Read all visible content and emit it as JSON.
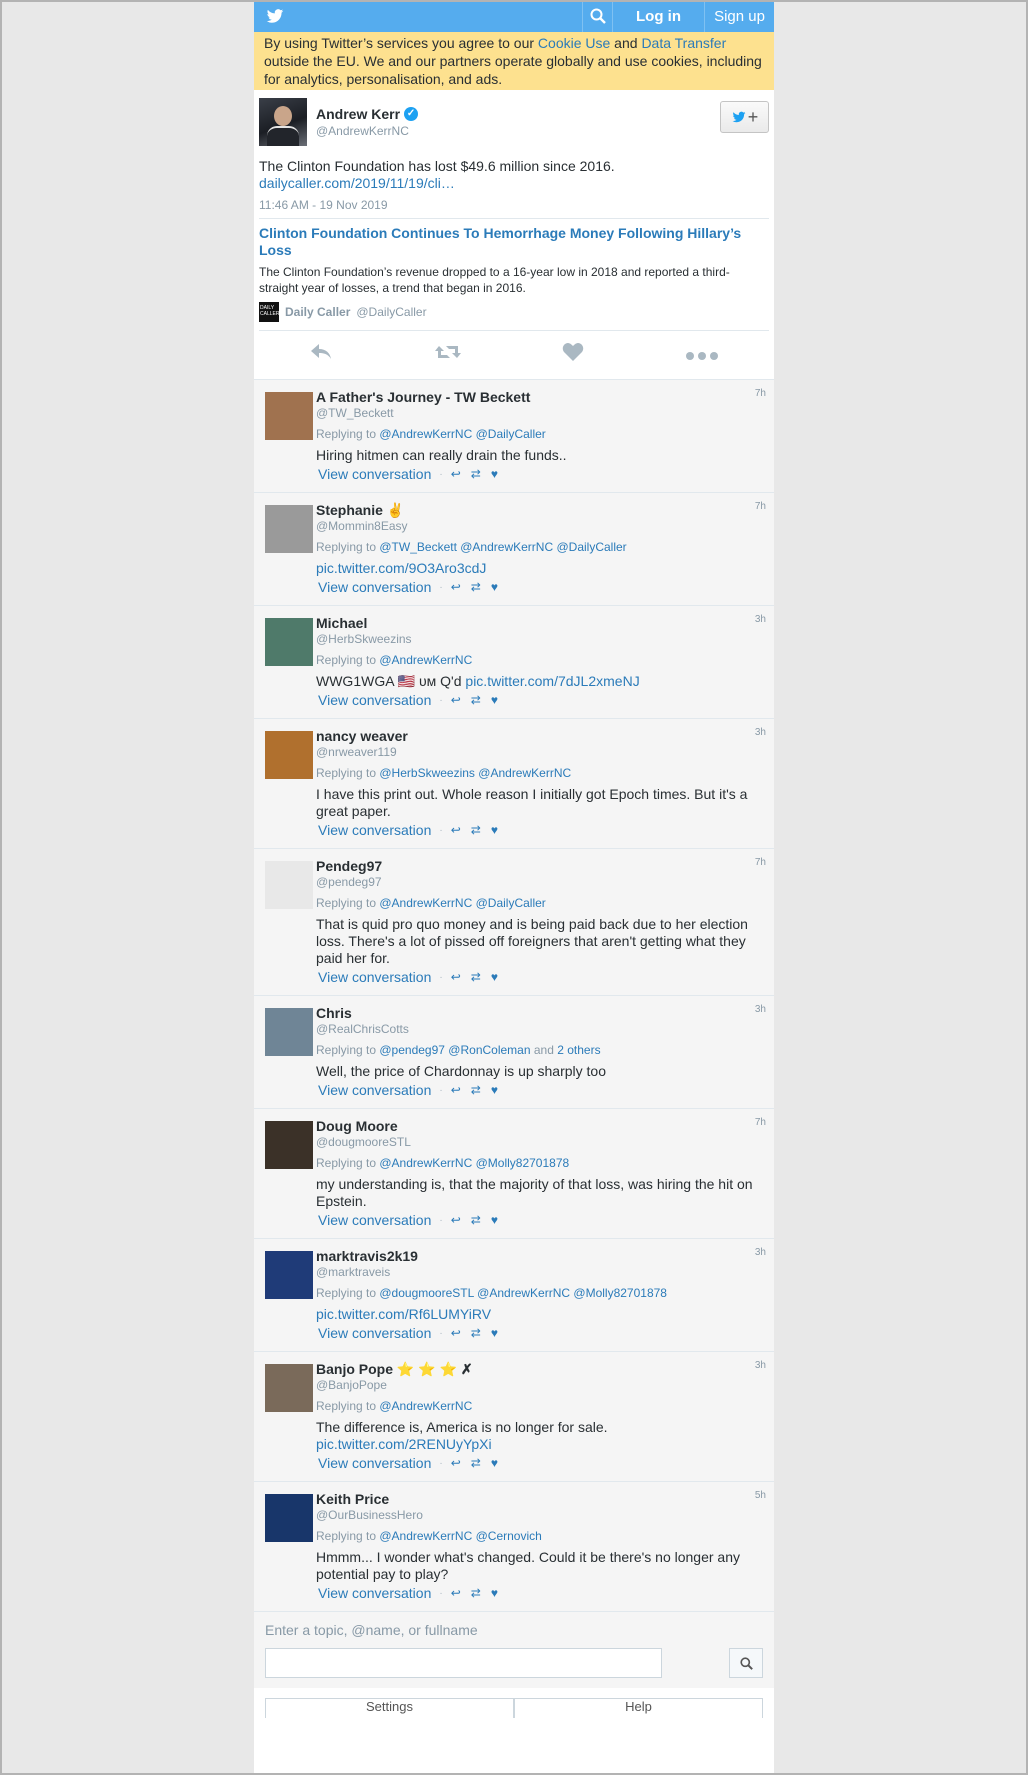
{
  "header": {
    "login_label": "Log in",
    "signup_label": "Sign up",
    "icons": [
      "twitter-bird-icon",
      "search-icon"
    ],
    "colors": {
      "bar": "#55acee",
      "link": "#2b7bb9",
      "cookie_bg": "#fde18f"
    }
  },
  "cookie": {
    "text_1": "By using Twitter’s services you agree to our ",
    "cookie_link": "Cookie Use",
    "text_2": " and ",
    "transfer_link": "Data Transfer",
    "text_3": " outside the EU. We and our partners operate globally and use cookies, including for analytics, personalisation, and ads."
  },
  "main_tweet": {
    "name": "Andrew Kerr",
    "handle": "@AndrewKerrNC",
    "text": "The Clinton Foundation has lost $49.6 million since 2016.",
    "link": "dailycaller.com/2019/11/19/cli…",
    "time": "11:46 AM - 19 Nov 2019",
    "card": {
      "title": "Clinton Foundation Continues To Hemorrhage Money Following Hillary’s Loss",
      "description": "The Clinton Foundation’s revenue dropped to a 16-year low in 2018 and reported a third-straight year of losses, a trend that began in 2016.",
      "source_name": "Daily Caller",
      "source_handle": "@DailyCaller",
      "source_logo_text": "DAILY CALLER"
    }
  },
  "replies": [
    {
      "name": "A Father's Journey - TW Beckett",
      "handle": "@TW_Beckett",
      "time": "7h",
      "replying_prefix": "Replying to ",
      "replying_to": [
        "@AndrewKerrNC",
        "@DailyCaller"
      ],
      "replying_suffix": "",
      "text": "Hiring hitmen can really drain the funds..",
      "link": "",
      "avatar_color": "#a0724f"
    },
    {
      "name": "Stephanie ✌",
      "handle": "@Mommin8Easy",
      "time": "7h",
      "replying_prefix": "Replying to ",
      "replying_to": [
        "@TW_Beckett",
        "@AndrewKerrNC",
        "@DailyCaller"
      ],
      "replying_suffix": "",
      "text": "",
      "link": "pic.twitter.com/9O3Aro3cdJ",
      "avatar_color": "#9a9a9a"
    },
    {
      "name": "Michael",
      "handle": "@HerbSkweezins",
      "time": "3h",
      "replying_prefix": "Replying to ",
      "replying_to": [
        "@AndrewKerrNC"
      ],
      "replying_suffix": "",
      "text": "WWG1WGA 🇺🇸 ᴜᴍ Q'd ",
      "link": "pic.twitter.com/7dJL2xmeNJ",
      "avatar_color": "#4f7a6a"
    },
    {
      "name": "nancy weaver",
      "handle": "@nrweaver119",
      "time": "3h",
      "replying_prefix": "Replying to ",
      "replying_to": [
        "@HerbSkweezins",
        "@AndrewKerrNC"
      ],
      "replying_suffix": "",
      "text": "I have this print out. Whole reason I initially got Epoch times. But it's a great paper.",
      "link": "",
      "avatar_color": "#b0702e"
    },
    {
      "name": "Pendeg97",
      "handle": "@pendeg97",
      "time": "7h",
      "replying_prefix": "Replying to ",
      "replying_to": [
        "@AndrewKerrNC",
        "@DailyCaller"
      ],
      "replying_suffix": "",
      "text": "That is quid pro quo money and is being paid back due to her election loss. There's a lot of pissed off foreigners that aren't getting what they paid her for.",
      "link": "",
      "avatar_color": "#e8e8e8"
    },
    {
      "name": "Chris",
      "handle": "@RealChrisCotts",
      "time": "3h",
      "replying_prefix": "Replying to ",
      "replying_to": [
        "@pendeg97",
        "@RonColeman"
      ],
      "replying_suffix": "2 others",
      "text": "Well, the price of Chardonnay is up sharply too",
      "link": "",
      "avatar_color": "#6f8596"
    },
    {
      "name": "Doug Moore",
      "handle": "@dougmooreSTL",
      "time": "7h",
      "replying_prefix": "Replying to ",
      "replying_to": [
        "@AndrewKerrNC",
        "@Molly82701878"
      ],
      "replying_suffix": "",
      "text": "my understanding is, that the majority of that loss, was hiring the hit on Epstein.",
      "link": "",
      "avatar_color": "#3b3128"
    },
    {
      "name": "marktravis2k19",
      "handle": "@marktraveis",
      "time": "3h",
      "replying_prefix": "Replying to ",
      "replying_to": [
        "@dougmooreSTL",
        "@AndrewKerrNC",
        "@Molly82701878"
      ],
      "replying_suffix": "",
      "text": "",
      "link": "pic.twitter.com/Rf6LUMYiRV",
      "avatar_color": "#1f3b78"
    },
    {
      "name": "Banjo Pope ⭐ ⭐ ⭐ ✗",
      "handle": "@BanjoPope",
      "time": "3h",
      "replying_prefix": "Replying to ",
      "replying_to": [
        "@AndrewKerrNC"
      ],
      "replying_suffix": "",
      "text": "The difference is, America is no longer for sale.",
      "link": "pic.twitter.com/2RENUyYpXi",
      "avatar_color": "#7a6a5a"
    },
    {
      "name": "Keith Price",
      "handle": "@OurBusinessHero",
      "time": "5h",
      "replying_prefix": "Replying to ",
      "replying_to": [
        "@AndrewKerrNC",
        "@Cernovich"
      ],
      "replying_suffix": "",
      "text": "Hmmm... I wonder what's changed. Could it be there's no longer any potential pay to play?",
      "link": "",
      "avatar_color": "#18366a"
    }
  ],
  "reply_labels": {
    "view_conversation": "View conversation",
    "and_text": " and "
  },
  "search": {
    "hint": "Enter a topic, @name, or fullname",
    "placeholder": ""
  },
  "bottom_tabs": {
    "settings": "Settings",
    "help": "Help"
  }
}
